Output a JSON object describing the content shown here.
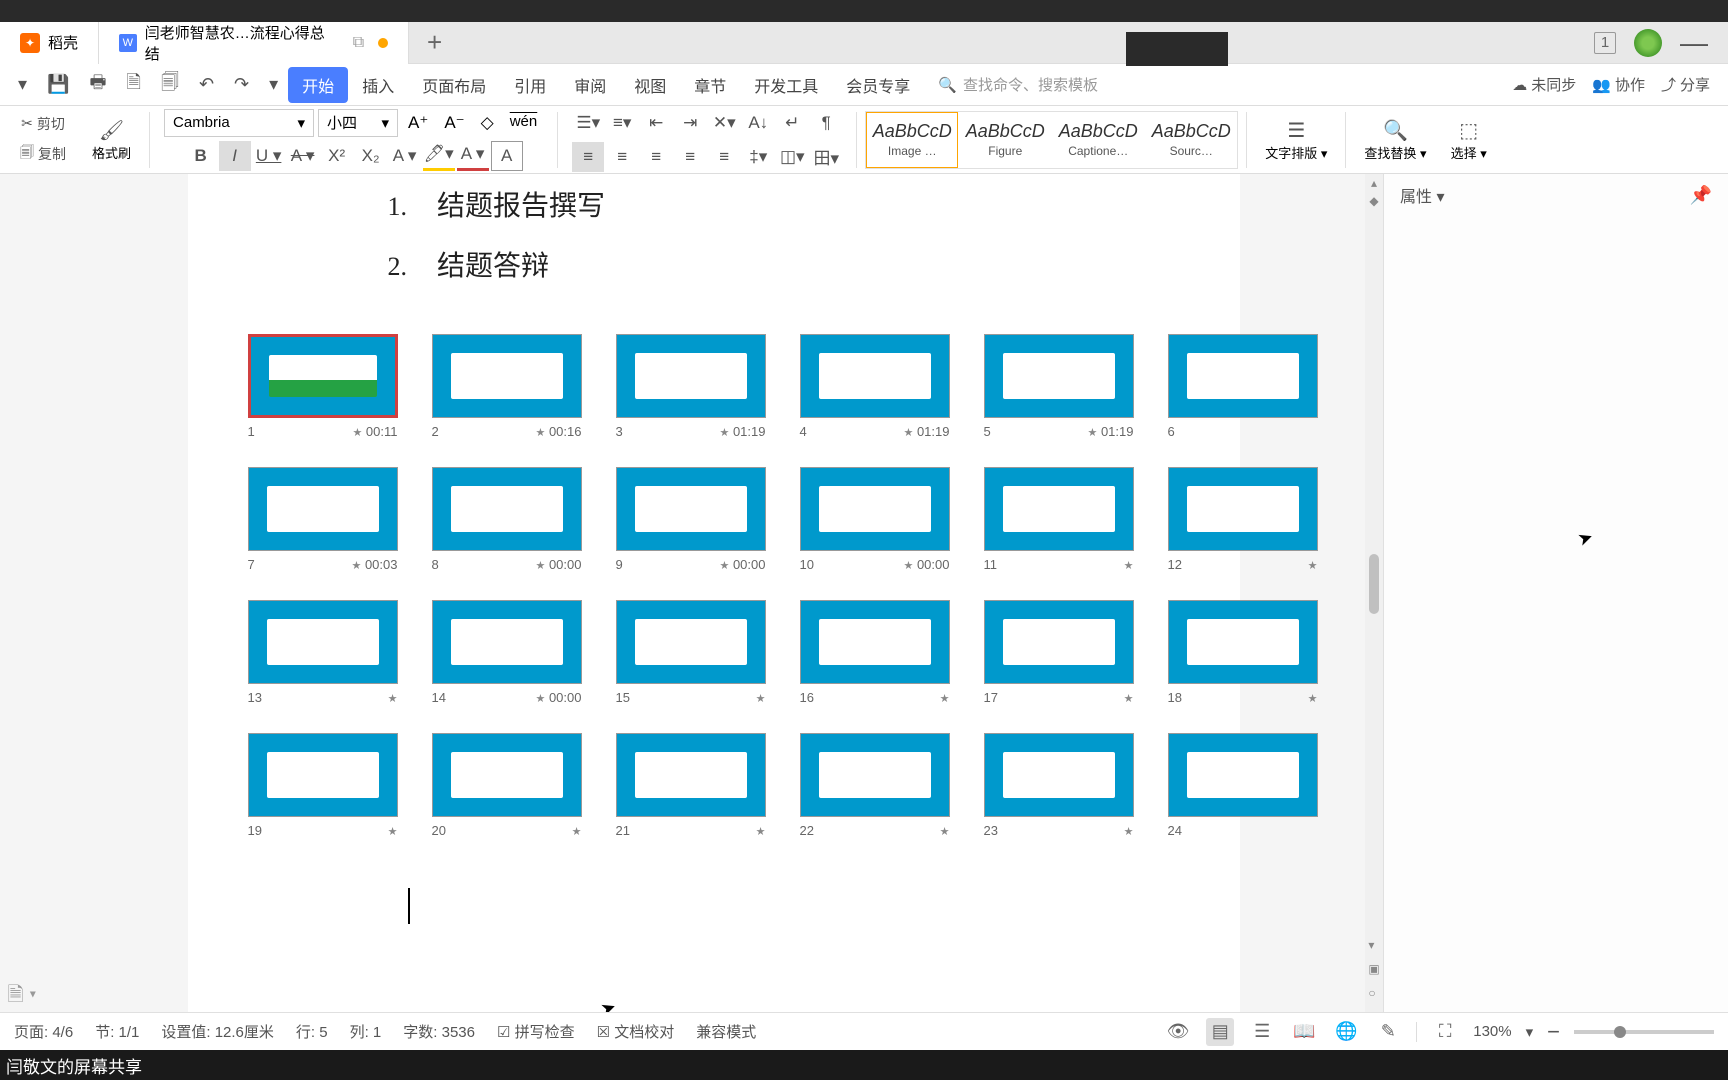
{
  "tabs": {
    "home": "稻壳",
    "doc": "闫老师智慧农…流程心得总结"
  },
  "topright": {
    "count": "1"
  },
  "quickbar": {
    "dropdown": "▾"
  },
  "menu": {
    "items": [
      "开始",
      "插入",
      "页面布局",
      "引用",
      "审阅",
      "视图",
      "章节",
      "开发工具",
      "会员专享"
    ],
    "search_ph": "查找命令、搜索模板",
    "unsync": "未同步",
    "coop": "协作",
    "share": "分享"
  },
  "ribbon": {
    "cut": "剪切",
    "copy": "复制",
    "brush": "格式刷",
    "font": "Cambria",
    "size": "小四",
    "styles": [
      {
        "preview": "AaBbCcD",
        "label": "Image …"
      },
      {
        "preview": "AaBbCcD",
        "label": "Figure"
      },
      {
        "preview": "AaBbCcD",
        "label": "Captione…"
      },
      {
        "preview": "AaBbCcD",
        "label": "Sourc…"
      }
    ],
    "text_layout": "文字排版",
    "find": "查找替换",
    "select": "选择"
  },
  "doc": {
    "line1_num": "1.",
    "line1_txt": "结题报告撰写",
    "line2_num": "2.",
    "line2_txt": "结题答辩"
  },
  "thumbs": [
    {
      "n": "1",
      "t": "00:11",
      "sel": true,
      "star": true
    },
    {
      "n": "2",
      "t": "00:16",
      "star": true
    },
    {
      "n": "3",
      "t": "01:19",
      "star": true
    },
    {
      "n": "4",
      "t": "01:19",
      "star": true
    },
    {
      "n": "5",
      "t": "01:19",
      "star": true
    },
    {
      "n": "6",
      "t": "",
      "star": false
    },
    {
      "n": "7",
      "t": "00:03",
      "star": true
    },
    {
      "n": "8",
      "t": "00:00",
      "star": true
    },
    {
      "n": "9",
      "t": "00:00",
      "star": true
    },
    {
      "n": "10",
      "t": "00:00",
      "star": true
    },
    {
      "n": "11",
      "t": "",
      "star": true
    },
    {
      "n": "12",
      "t": "",
      "star": true
    },
    {
      "n": "13",
      "t": "",
      "star": true
    },
    {
      "n": "14",
      "t": "00:00",
      "star": true
    },
    {
      "n": "15",
      "t": "",
      "star": true
    },
    {
      "n": "16",
      "t": "",
      "star": true
    },
    {
      "n": "17",
      "t": "",
      "star": true
    },
    {
      "n": "18",
      "t": "",
      "star": true
    },
    {
      "n": "19",
      "t": "",
      "star": true
    },
    {
      "n": "20",
      "t": "",
      "star": true
    },
    {
      "n": "21",
      "t": "",
      "star": true
    },
    {
      "n": "22",
      "t": "",
      "star": true
    },
    {
      "n": "23",
      "t": "",
      "star": true
    },
    {
      "n": "24",
      "t": "",
      "star": false
    }
  ],
  "side": {
    "title": "属性"
  },
  "status": {
    "page": "页面: 4/6",
    "section": "节: 1/1",
    "indent": "设置值: 12.6厘米",
    "row": "行: 5",
    "col": "列: 1",
    "words": "字数: 3536",
    "spell": "拼写检查",
    "proof": "文档校对",
    "compat": "兼容模式",
    "zoom": "130%"
  },
  "share": "闫敬文的屏幕共享"
}
